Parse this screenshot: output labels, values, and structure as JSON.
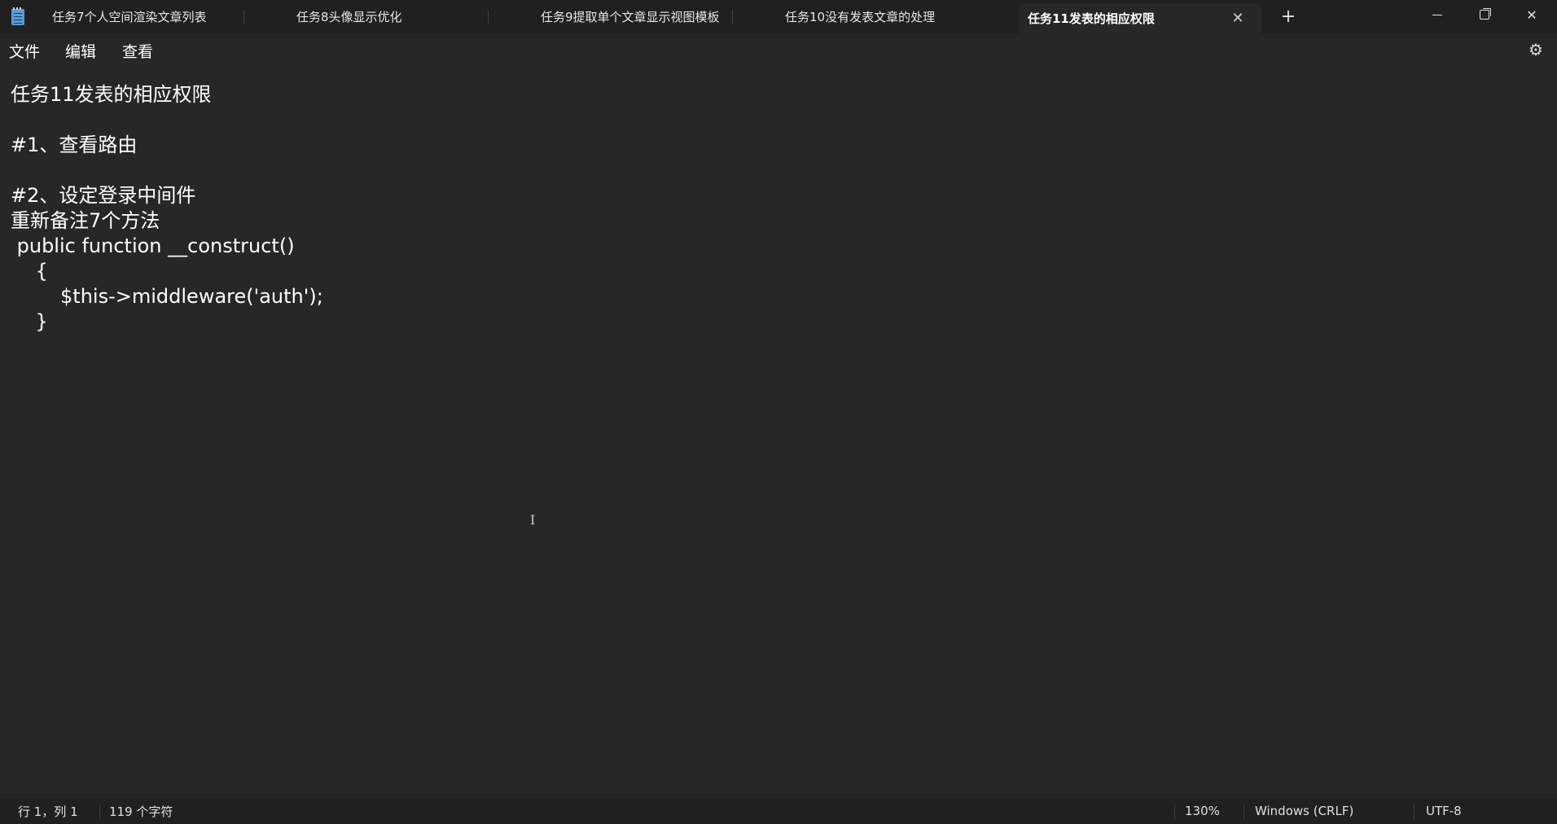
{
  "tabs": [
    {
      "label": "任务7个人空间渲染文章列表"
    },
    {
      "label": "任务8头像显示优化"
    },
    {
      "label": "任务9提取单个文章显示视图模板"
    },
    {
      "label": "任务10没有发表文章的处理"
    },
    {
      "label": "任务11发表的相应权限",
      "active": true
    }
  ],
  "icons": {
    "app": "notepad-icon",
    "close_tab": "✕",
    "new_tab": "+",
    "minimize": "minimize-icon",
    "maximize": "restore-icon",
    "close_window": "✕",
    "settings": "⚙",
    "cursor": "I"
  },
  "menu": {
    "file": "文件",
    "edit": "编辑",
    "view": "查看"
  },
  "editor": {
    "content": "任务11发表的相应权限\n\n#1、查看路由\n\n#2、设定登录中间件\n重新备注7个方法\n public function __construct()\n    {\n        $this->middleware('auth');\n    }"
  },
  "status": {
    "position": "行 1，列 1",
    "char_count": "119 个字符",
    "zoom": "130%",
    "line_ending": "Windows (CRLF)",
    "encoding": "UTF-8"
  },
  "colors": {
    "titlebar_bg": "#202020",
    "editor_bg": "#272727",
    "text": "#ffffff"
  }
}
